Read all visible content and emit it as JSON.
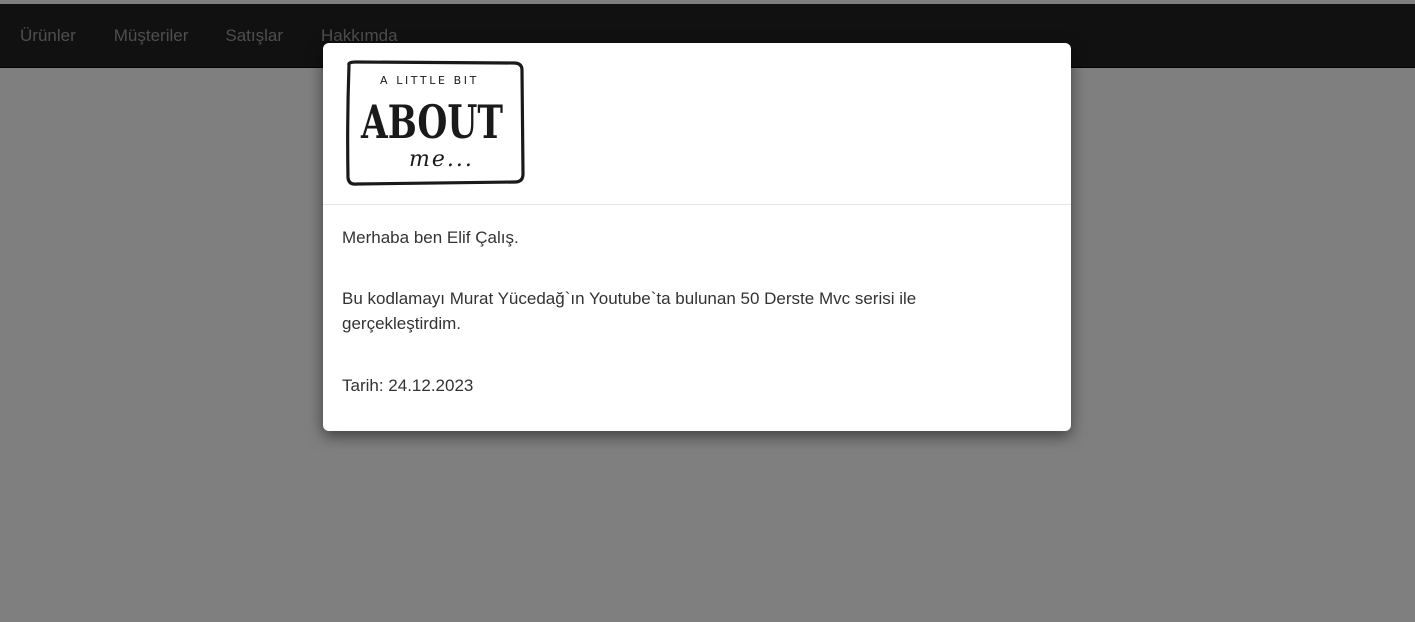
{
  "navbar": {
    "items": [
      {
        "label": "Ürünler"
      },
      {
        "label": "Müşteriler"
      },
      {
        "label": "Satışlar"
      },
      {
        "label": "Hakkımda"
      }
    ]
  },
  "modal": {
    "logo": {
      "line1": "A LITTLE BIT",
      "line2": "ABOUT",
      "line3": "me..."
    },
    "greeting": "Merhaba ben Elif Çalış.",
    "description": "Bu kodlamayı Murat Yücedağ`ın Youtube`ta bulunan 50 Derste Mvc serisi ile gerçekleştirdim.",
    "date": "Tarih: 24.12.2023"
  },
  "colors": {
    "navbar_bg": "#222222",
    "nav_text": "#9d9d9d",
    "backdrop": "rgba(0,0,0,0.5)",
    "modal_bg": "#ffffff",
    "body_text": "#333333"
  }
}
